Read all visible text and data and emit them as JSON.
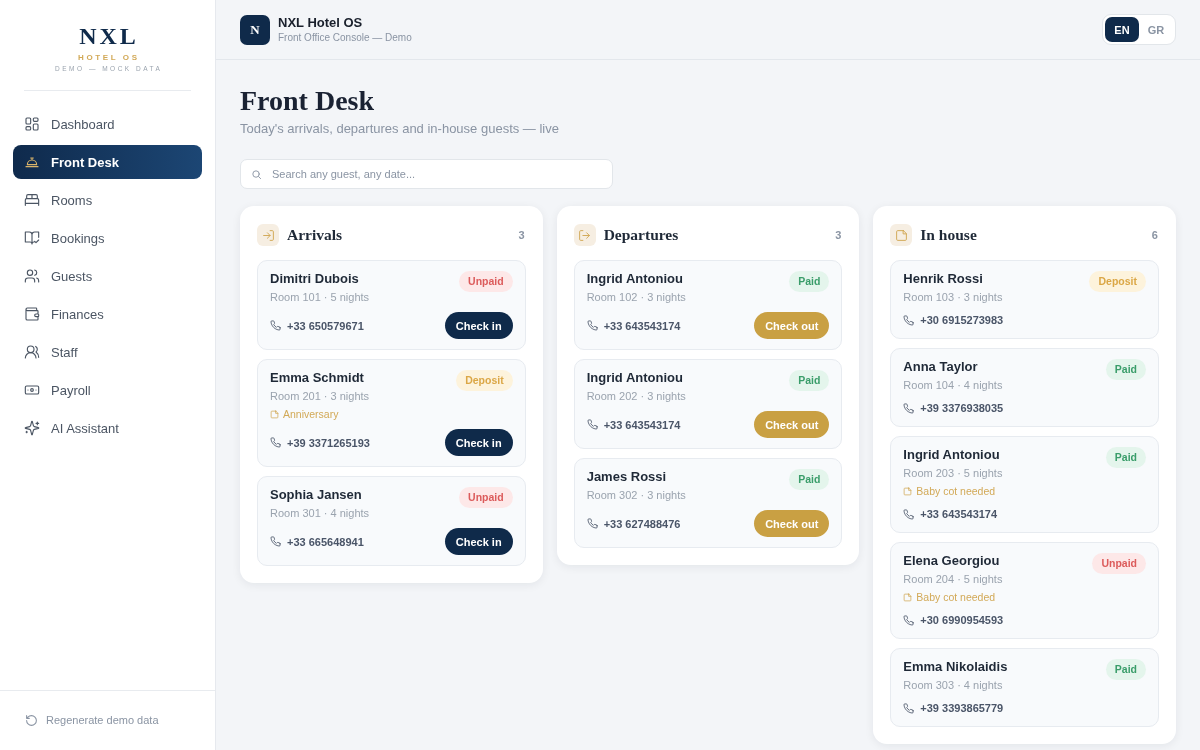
{
  "sidebar": {
    "brand": {
      "name": "NXL",
      "tagline": "HOTEL OS",
      "subtitle": "DEMO — MOCK DATA"
    },
    "items": [
      {
        "label": "Dashboard",
        "selected": false
      },
      {
        "label": "Front Desk",
        "selected": true
      },
      {
        "label": "Rooms",
        "selected": false
      },
      {
        "label": "Bookings",
        "selected": false
      },
      {
        "label": "Guests",
        "selected": false
      },
      {
        "label": "Finances",
        "selected": false
      },
      {
        "label": "Staff",
        "selected": false
      },
      {
        "label": "Payroll",
        "selected": false
      },
      {
        "label": "AI Assistant",
        "selected": false
      }
    ],
    "footer_action": "Regenerate demo data"
  },
  "header": {
    "logo_letter": "N",
    "title": "NXL Hotel OS",
    "subtitle": "Front Office Console — Demo",
    "languages": [
      {
        "label": "EN",
        "selected": true
      },
      {
        "label": "GR",
        "selected": false
      }
    ]
  },
  "page": {
    "title": "Front Desk",
    "subtitle": "Today's arrivals, departures and in-house guests — live"
  },
  "search": {
    "placeholder": "Search any guest, any date..."
  },
  "columns": [
    {
      "kind": "arrivals",
      "title": "Arrivals",
      "count": "3",
      "cards": [
        {
          "name": "Dimitri Dubois",
          "room": "Room 101 · 5 nights",
          "badge": {
            "text": "Unpaid",
            "kind": "unpaid"
          },
          "phone": "+33 650579671",
          "action": {
            "label": "Check in",
            "kind": "check_in"
          }
        },
        {
          "name": "Emma Schmidt",
          "room": "Room 201 · 3 nights",
          "badge": {
            "text": "Deposit",
            "kind": "deposit"
          },
          "note": "Anniversary",
          "phone": "+39 3371265193",
          "action": {
            "label": "Check in",
            "kind": "check_in"
          }
        },
        {
          "name": "Sophia Jansen",
          "room": "Room 301 · 4 nights",
          "badge": {
            "text": "Unpaid",
            "kind": "unpaid"
          },
          "phone": "+33 665648941",
          "action": {
            "label": "Check in",
            "kind": "check_in"
          }
        }
      ]
    },
    {
      "kind": "departures",
      "title": "Departures",
      "count": "3",
      "cards": [
        {
          "name": "Ingrid Antoniou",
          "room": "Room 102 · 3 nights",
          "badge": {
            "text": "Paid",
            "kind": "paid"
          },
          "phone": "+33 643543174",
          "action": {
            "label": "Check out",
            "kind": "check_out"
          }
        },
        {
          "name": "Ingrid Antoniou",
          "room": "Room 202 · 3 nights",
          "badge": {
            "text": "Paid",
            "kind": "paid"
          },
          "phone": "+33 643543174",
          "action": {
            "label": "Check out",
            "kind": "check_out"
          }
        },
        {
          "name": "James Rossi",
          "room": "Room 302 · 3 nights",
          "badge": {
            "text": "Paid",
            "kind": "paid"
          },
          "phone": "+33 627488476",
          "action": {
            "label": "Check out",
            "kind": "check_out"
          }
        }
      ]
    },
    {
      "kind": "in_house",
      "title": "In house",
      "count": "6",
      "cards": [
        {
          "name": "Henrik Rossi",
          "room": "Room 103 · 3 nights",
          "badge": {
            "text": "Deposit",
            "kind": "deposit"
          },
          "phone": "+30 6915273983"
        },
        {
          "name": "Anna Taylor",
          "room": "Room 104 · 4 nights",
          "badge": {
            "text": "Paid",
            "kind": "paid"
          },
          "phone": "+39 3376938035"
        },
        {
          "name": "Ingrid Antoniou",
          "room": "Room 203 · 5 nights",
          "badge": {
            "text": "Paid",
            "kind": "paid"
          },
          "note": "Baby cot needed",
          "phone": "+33 643543174"
        },
        {
          "name": "Elena Georgiou",
          "room": "Room 204 · 5 nights",
          "badge": {
            "text": "Unpaid",
            "kind": "unpaid"
          },
          "note": "Baby cot needed",
          "phone": "+30 6990954593"
        },
        {
          "name": "Emma Nikolaidis",
          "room": "Room 303 · 4 nights",
          "badge": {
            "text": "Paid",
            "kind": "paid"
          },
          "phone": "+39 3393865779"
        }
      ]
    }
  ]
}
